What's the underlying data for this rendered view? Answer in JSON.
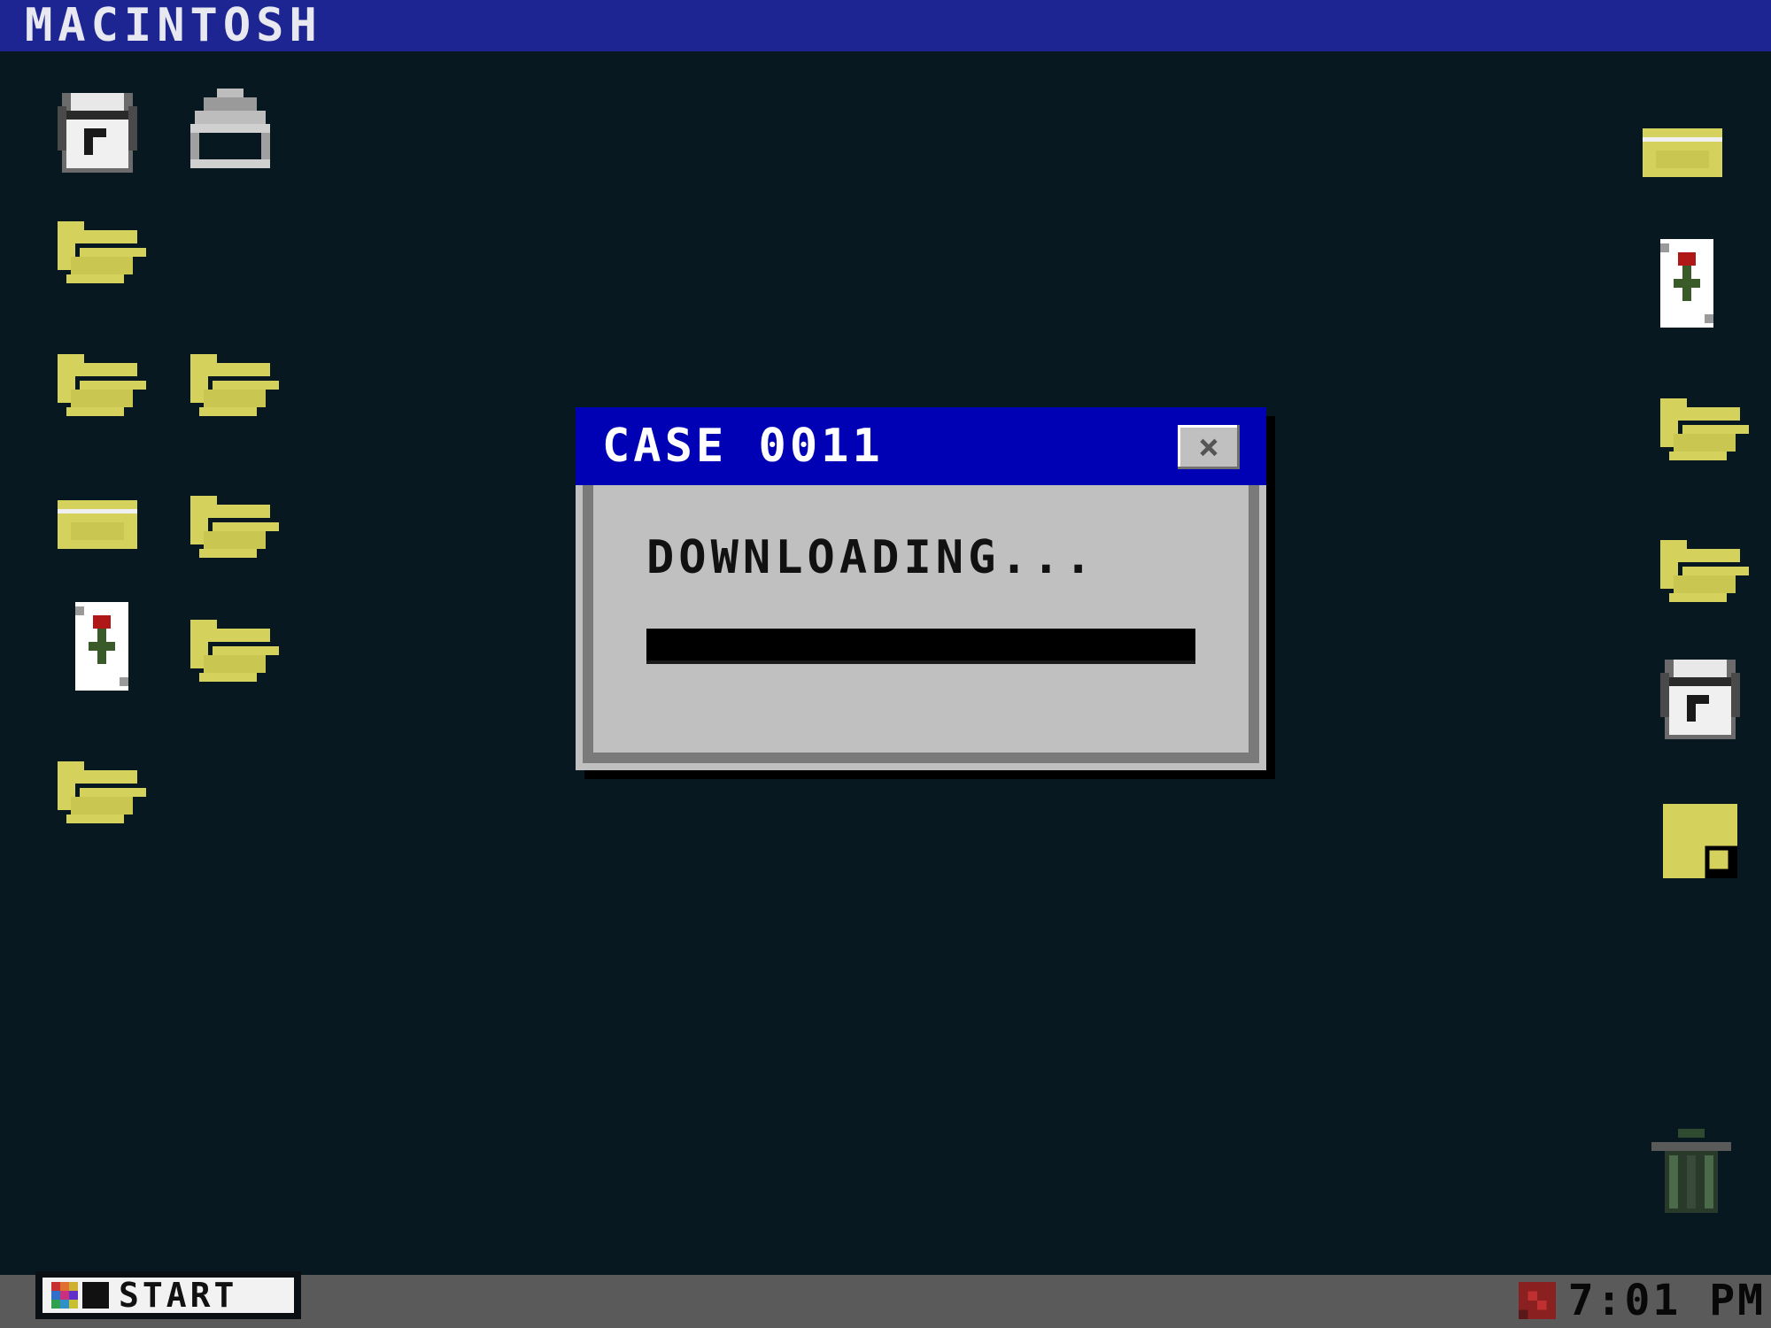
{
  "top_bar": {
    "title": "MACINTOSH"
  },
  "desktop_icons_left": [
    {
      "icon": "floppy-disk-icon"
    },
    {
      "icon": "printer-icon"
    },
    {
      "icon": "open-folder-icon"
    },
    {
      "icon": "open-folder-icon"
    },
    {
      "icon": "open-folder-icon"
    },
    {
      "icon": "closed-folder-icon"
    },
    {
      "icon": "open-folder-icon"
    },
    {
      "icon": "rose-card-icon"
    },
    {
      "icon": "open-folder-icon"
    },
    {
      "icon": "open-folder-icon"
    }
  ],
  "desktop_icons_right": [
    {
      "icon": "closed-folder-icon"
    },
    {
      "icon": "rose-card-icon"
    },
    {
      "icon": "open-folder-icon"
    },
    {
      "icon": "open-folder-icon"
    },
    {
      "icon": "floppy-disk-icon"
    },
    {
      "icon": "sticky-note-icon"
    },
    {
      "icon": "trash-can-icon"
    }
  ],
  "dialog": {
    "title": "CASE 0011",
    "close_label": "×",
    "message": "DOWNLOADING...",
    "progress": 1.0
  },
  "taskbar": {
    "start_label": "START",
    "clock": "7:01 PM"
  },
  "colors": {
    "desktop": "#081820",
    "top_bar": "#1c2591",
    "dialog_title": "#0000b4",
    "dialog_body": "#c0c0c0",
    "folder": "#d4d15c",
    "taskbar": "#5a5a5a"
  }
}
